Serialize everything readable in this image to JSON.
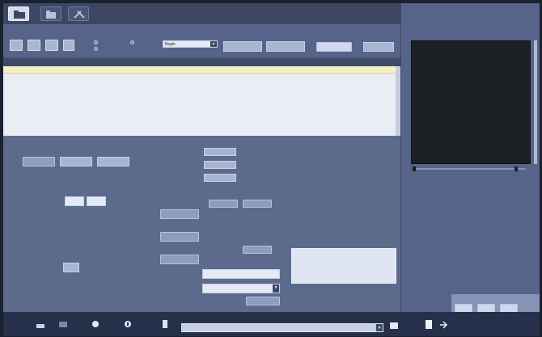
{
  "toolbar": {
    "tabs": [
      {
        "icon": "folder-open-icon"
      },
      {
        "icon": "folder-icon"
      },
      {
        "icon": "tools-icon"
      }
    ]
  },
  "filter": {
    "group1_label": "",
    "group2_label": "",
    "radio_labels": [
      "",
      "",
      ""
    ],
    "group3_label": "",
    "select_value": "Begin",
    "date_from_label": "",
    "date_to_label": "",
    "search_group_label": "",
    "search_button": "",
    "field4": ""
  },
  "table": {
    "columns": [
      "",
      "",
      "",
      "",
      "",
      "",
      "",
      "",
      "",
      "",
      "",
      "",
      ""
    ],
    "rows": [
      {
        "cells": [
          "",
          "",
          "",
          "",
          "",
          "",
          "",
          "",
          "",
          "",
          ""
        ]
      }
    ]
  },
  "left_panel": {
    "title": "",
    "labels": [
      "",
      "",
      "",
      "",
      "",
      "",
      ""
    ],
    "values": [
      "",
      ""
    ],
    "button1": ""
  },
  "mid_panel": {
    "title": "",
    "field_labels": [
      "",
      "",
      "",
      "",
      "",
      ""
    ],
    "button_left": [
      "",
      "",
      ""
    ],
    "button_right": [
      "",
      "",
      ""
    ],
    "input_value": "",
    "select_value": "",
    "apply_button": ""
  },
  "right_text_panel": {
    "title": "",
    "lines": [
      "",
      "",
      ""
    ]
  },
  "preview": {
    "title": "",
    "subtitle": ""
  },
  "bottom_right_buttons": [
    "",
    "",
    ""
  ],
  "taskbar": {
    "clock": "",
    "icons": [
      "start-icon",
      "folder-icon",
      "settings-icon",
      "info-icon",
      "usb-icon",
      "print-icon",
      "arrow-icon"
    ]
  }
}
